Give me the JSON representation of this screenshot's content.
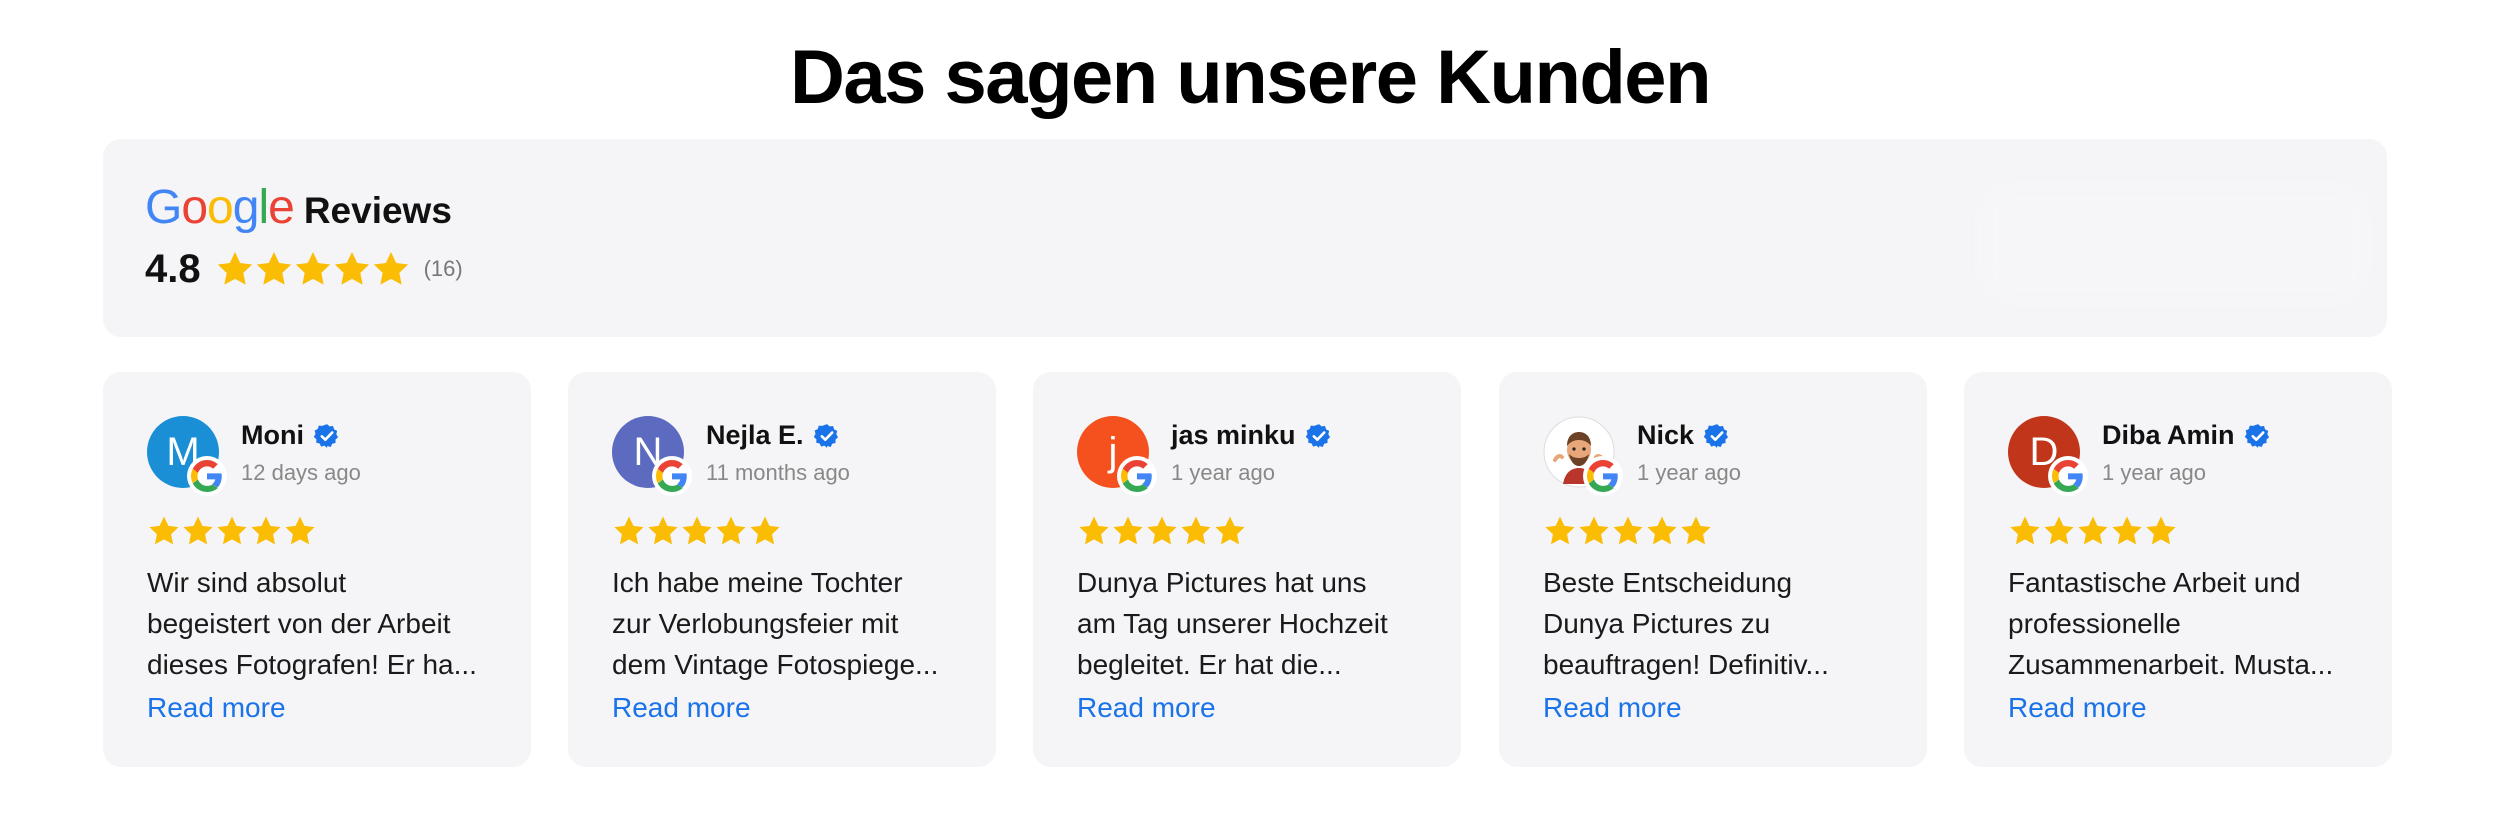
{
  "page": {
    "title": "Das sagen unsere Kunden"
  },
  "header": {
    "brand": "Google",
    "label": "Reviews",
    "rating": "4.8",
    "star_count": 5,
    "review_count": "(16)"
  },
  "colors": {
    "star": "#fbbc04",
    "link": "#1a73e8",
    "verified": "#1a73e8",
    "card_bg": "#f5f5f7"
  },
  "reviews": [
    {
      "name": "Moni",
      "initial": "M",
      "avatar_color": "#1a8fd6",
      "date": "12 days ago",
      "stars": 5,
      "lines": [
        "Wir sind absolut",
        "begeistert von der Arbeit",
        "dieses Fotografen! Er ha..."
      ],
      "read_more": "Read more"
    },
    {
      "name": "Nejla E.",
      "initial": "N",
      "avatar_color": "#5c6bc0",
      "date": "11 months ago",
      "stars": 5,
      "lines": [
        "Ich habe meine Tochter",
        "zur Verlobungsfeier mit",
        "dem Vintage Fotospiege..."
      ],
      "read_more": "Read more"
    },
    {
      "name": "jas minku",
      "initial": "j",
      "avatar_color": "#f4511e",
      "date": "1 year ago",
      "stars": 5,
      "lines": [
        "Dunya Pictures hat uns",
        "am Tag unserer Hochzeit",
        "begleitet. Er hat die..."
      ],
      "read_more": "Read more"
    },
    {
      "name": "Nick",
      "initial": "",
      "avatar_icon": "memoji-avatar",
      "avatar_color": "#ffffff",
      "date": "1 year ago",
      "stars": 5,
      "lines": [
        "Beste Entscheidung",
        "Dunya Pictures zu",
        "beauftragen! Definitiv..."
      ],
      "read_more": "Read more"
    },
    {
      "name": "Diba Amin",
      "initial": "D",
      "avatar_color": "#c1351b",
      "date": "1 year ago",
      "stars": 5,
      "lines": [
        "Fantastische Arbeit und",
        "professionelle",
        "Zusammenarbeit. Musta..."
      ],
      "read_more": "Read more"
    }
  ]
}
